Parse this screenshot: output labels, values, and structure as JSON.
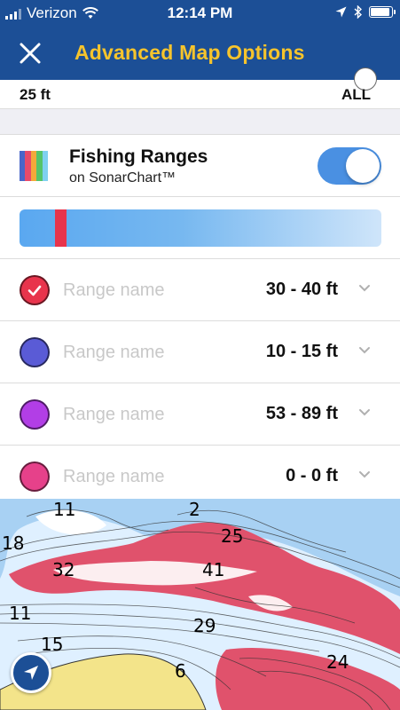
{
  "status_bar": {
    "carrier": "Verizon",
    "time": "12:14 PM",
    "battery_level": 0.9
  },
  "nav": {
    "title": "Advanced Map Options",
    "close_icon": "close-icon"
  },
  "depth_filter": {
    "min_label": "25 ft",
    "max_label": "ALL"
  },
  "fishing_ranges": {
    "title": "Fishing Ranges",
    "subtitle": "on SonarChart™",
    "enabled": true,
    "icon_colors": [
      "#4a66c9",
      "#e84a6a",
      "#f4a93a",
      "#55c46a",
      "#7fd0f0"
    ],
    "toggle_color": "#4a90e2"
  },
  "depth_gradient": {
    "start_color": "#5aa8f0",
    "end_color": "#cfe5fa",
    "marker_color": "#e8344c",
    "marker_start_fraction": 0.098,
    "marker_end_fraction": 0.13
  },
  "ranges": [
    {
      "name_placeholder": "Range name",
      "value": "30 - 40 ft",
      "color": "#e8344c",
      "selected": true
    },
    {
      "name_placeholder": "Range name",
      "value": "10 - 15 ft",
      "color": "#5a5bd6",
      "selected": false
    },
    {
      "name_placeholder": "Range name",
      "value": "53 - 89 ft",
      "color": "#b23ee6",
      "selected": false
    },
    {
      "name_placeholder": "Range name",
      "value": "0 - 0 ft",
      "color": "#e6418a",
      "selected": false
    }
  ],
  "map": {
    "depth_labels": [
      "11",
      "2",
      "25",
      "18",
      "32",
      "41",
      "11",
      "29",
      "15",
      "6",
      "24"
    ],
    "water_color": "#a8d1f3",
    "shallow_color": "#dff0ff",
    "highlight_color": "#e0526c",
    "land_color": "#f3e48a",
    "locate_icon": "navigation-arrow-icon"
  }
}
